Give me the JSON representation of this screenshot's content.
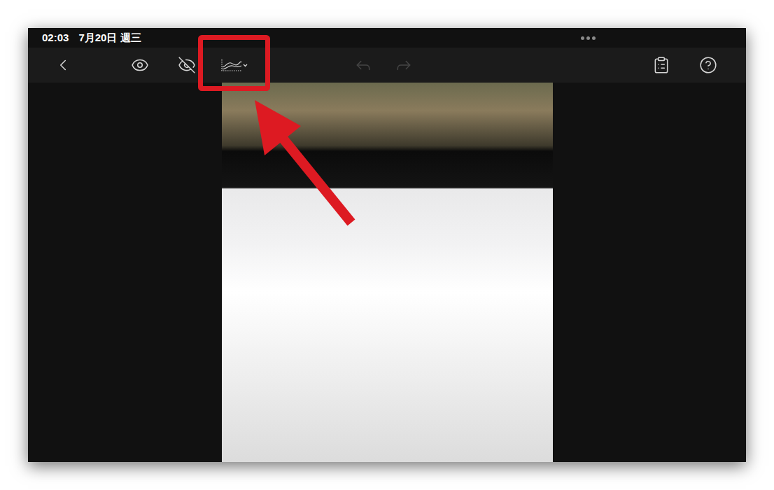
{
  "status_bar": {
    "time": "02:03",
    "date": "7月20日 週三"
  },
  "toolbar": {
    "items": [
      {
        "kind": "back",
        "disabled": false,
        "highlighted": false
      },
      {
        "kind": "eye",
        "disabled": false,
        "highlighted": false
      },
      {
        "kind": "eye-off",
        "disabled": false,
        "highlighted": false
      },
      {
        "kind": "curve",
        "disabled": false,
        "highlighted": true
      },
      {
        "kind": "undo",
        "disabled": true,
        "highlighted": false
      },
      {
        "kind": "redo",
        "disabled": true,
        "highlighted": false
      },
      {
        "kind": "clipboard",
        "disabled": false,
        "highlighted": false
      },
      {
        "kind": "help",
        "disabled": false,
        "highlighted": false
      }
    ]
  }
}
